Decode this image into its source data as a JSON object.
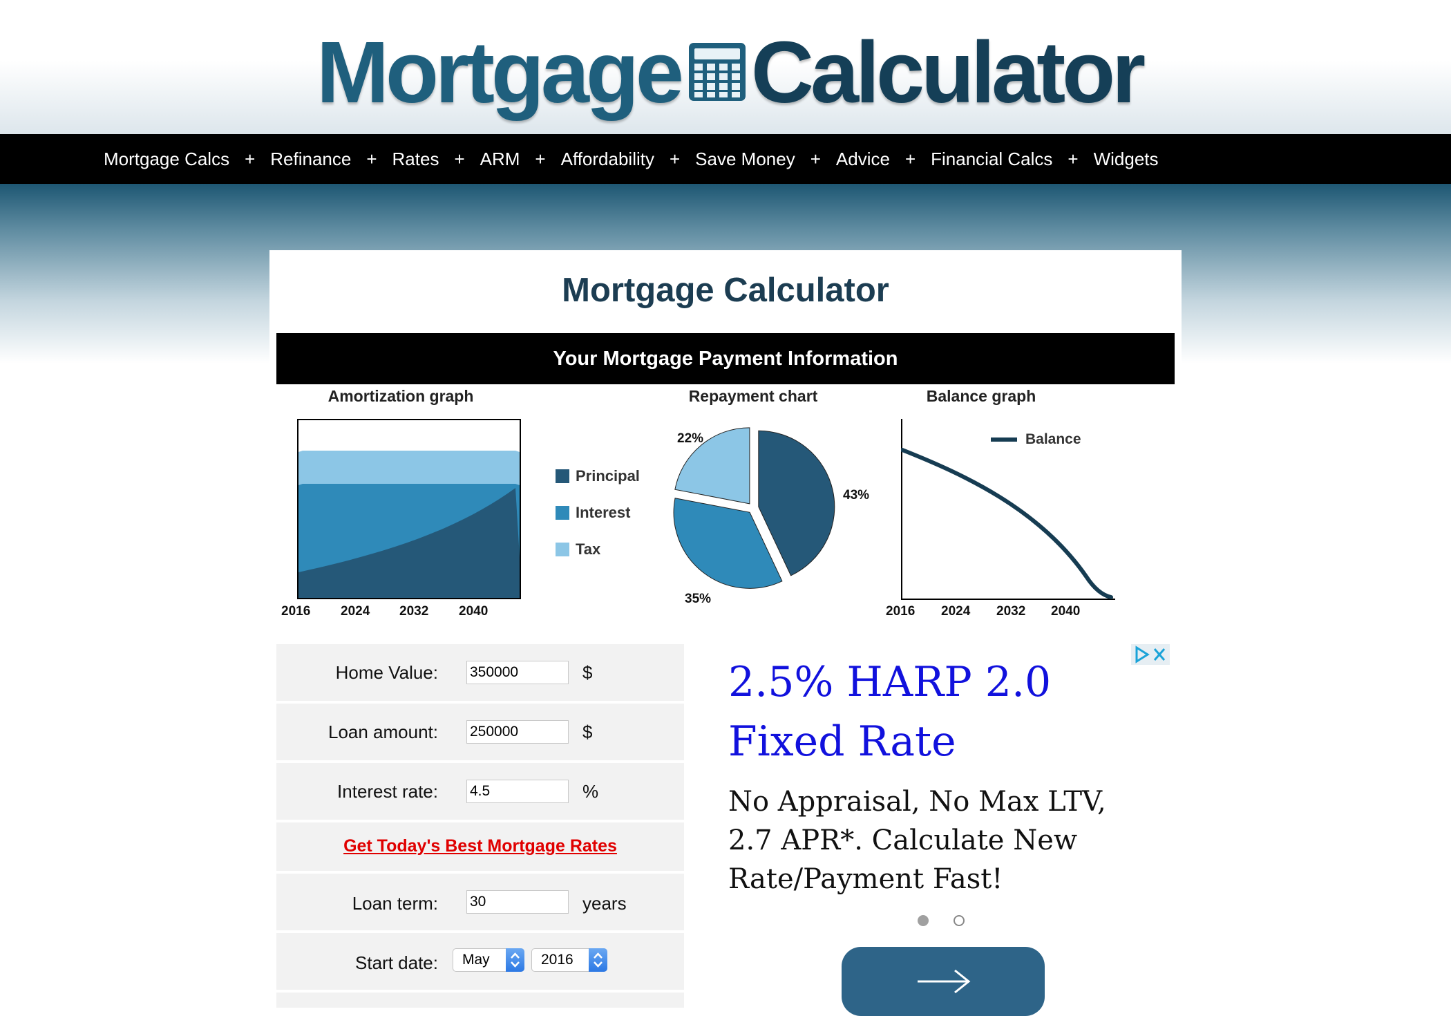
{
  "logo": {
    "word1": "Mortgage",
    "word2": "Calculator"
  },
  "nav": {
    "items": [
      "Mortgage Calcs",
      "Refinance",
      "Rates",
      "ARM",
      "Affordability",
      "Save Money",
      "Advice",
      "Financial Calcs",
      "Widgets"
    ],
    "separator": "+"
  },
  "page": {
    "title": "Mortgage Calculator",
    "info_bar": "Your Mortgage Payment Information"
  },
  "charts": {
    "amortization_title": "Amortization graph",
    "repayment_title": "Repayment chart",
    "balance_title": "Balance graph",
    "legend": [
      "Principal",
      "Interest",
      "Tax"
    ],
    "balance_legend": "Balance"
  },
  "chart_data": [
    {
      "type": "area",
      "title": "Amortization graph",
      "x_ticks": [
        "2016",
        "2024",
        "2032",
        "2040"
      ],
      "series": [
        {
          "name": "Principal",
          "color": "#255878"
        },
        {
          "name": "Interest",
          "color": "#2f8ab9"
        },
        {
          "name": "Tax",
          "color": "#8cc6e6"
        }
      ]
    },
    {
      "type": "pie",
      "title": "Repayment chart",
      "slices": [
        {
          "label": "Principal",
          "value": 43,
          "text": "43%",
          "color": "#255878"
        },
        {
          "label": "Interest",
          "value": 35,
          "text": "35%",
          "color": "#2f8ab9"
        },
        {
          "label": "Tax",
          "value": 22,
          "text": "22%",
          "color": "#8cc6e6"
        }
      ]
    },
    {
      "type": "line",
      "title": "Balance graph",
      "x_ticks": [
        "2016",
        "2024",
        "2032",
        "2040"
      ],
      "series": [
        {
          "name": "Balance",
          "color": "#163c52"
        }
      ]
    }
  ],
  "form": {
    "home_value": {
      "label": "Home Value:",
      "value": "350000",
      "unit": "$"
    },
    "loan_amount": {
      "label": "Loan amount:",
      "value": "250000",
      "unit": "$"
    },
    "interest_rate": {
      "label": "Interest rate:",
      "value": "4.5",
      "unit": "%"
    },
    "rates_link": "Get Today's Best Mortgage Rates",
    "loan_term": {
      "label": "Loan term:",
      "value": "30",
      "unit": "years"
    },
    "start_date": {
      "label": "Start date:",
      "month": "May",
      "year": "2016"
    }
  },
  "ad": {
    "headline": "2.5% HARP 2.0 Fixed Rate",
    "body": "No Appraisal, No Max LTV, 2.7 APR*. Calculate New Rate/Payment Fast!",
    "active_slide": 1,
    "slides": 2
  },
  "colors": {
    "nav_bg": "#000000",
    "principal": "#255878",
    "interest": "#2f8ab9",
    "tax": "#8cc6e6",
    "link_red": "#e00000",
    "ad_blue": "#1111dd",
    "cta_button": "#2e6488"
  }
}
